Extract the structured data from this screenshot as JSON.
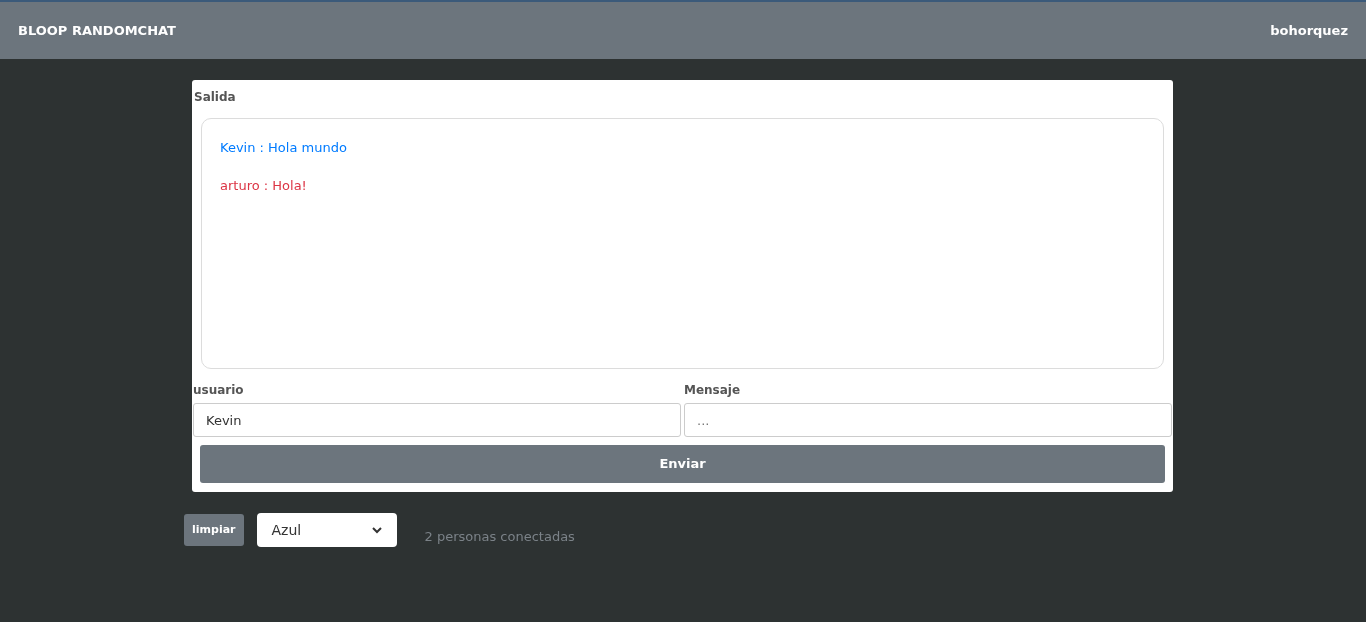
{
  "navbar": {
    "brand": "BLOOP RANDOMCHAT",
    "user": "bohorquez"
  },
  "output": {
    "label": "Salida",
    "messages": [
      {
        "text": "Kevin : Hola mundo",
        "color": "#007bff"
      },
      {
        "text": "arturo : Hola!",
        "color": "#dc3545"
      }
    ]
  },
  "form": {
    "user_label": "usuario",
    "user_value": "Kevin",
    "message_label": "Mensaje",
    "message_placeholder": "...",
    "send_button": "Enviar"
  },
  "footer": {
    "clear_button": "limpiar",
    "color_select": "Azul",
    "status": "2 personas conectadas"
  }
}
